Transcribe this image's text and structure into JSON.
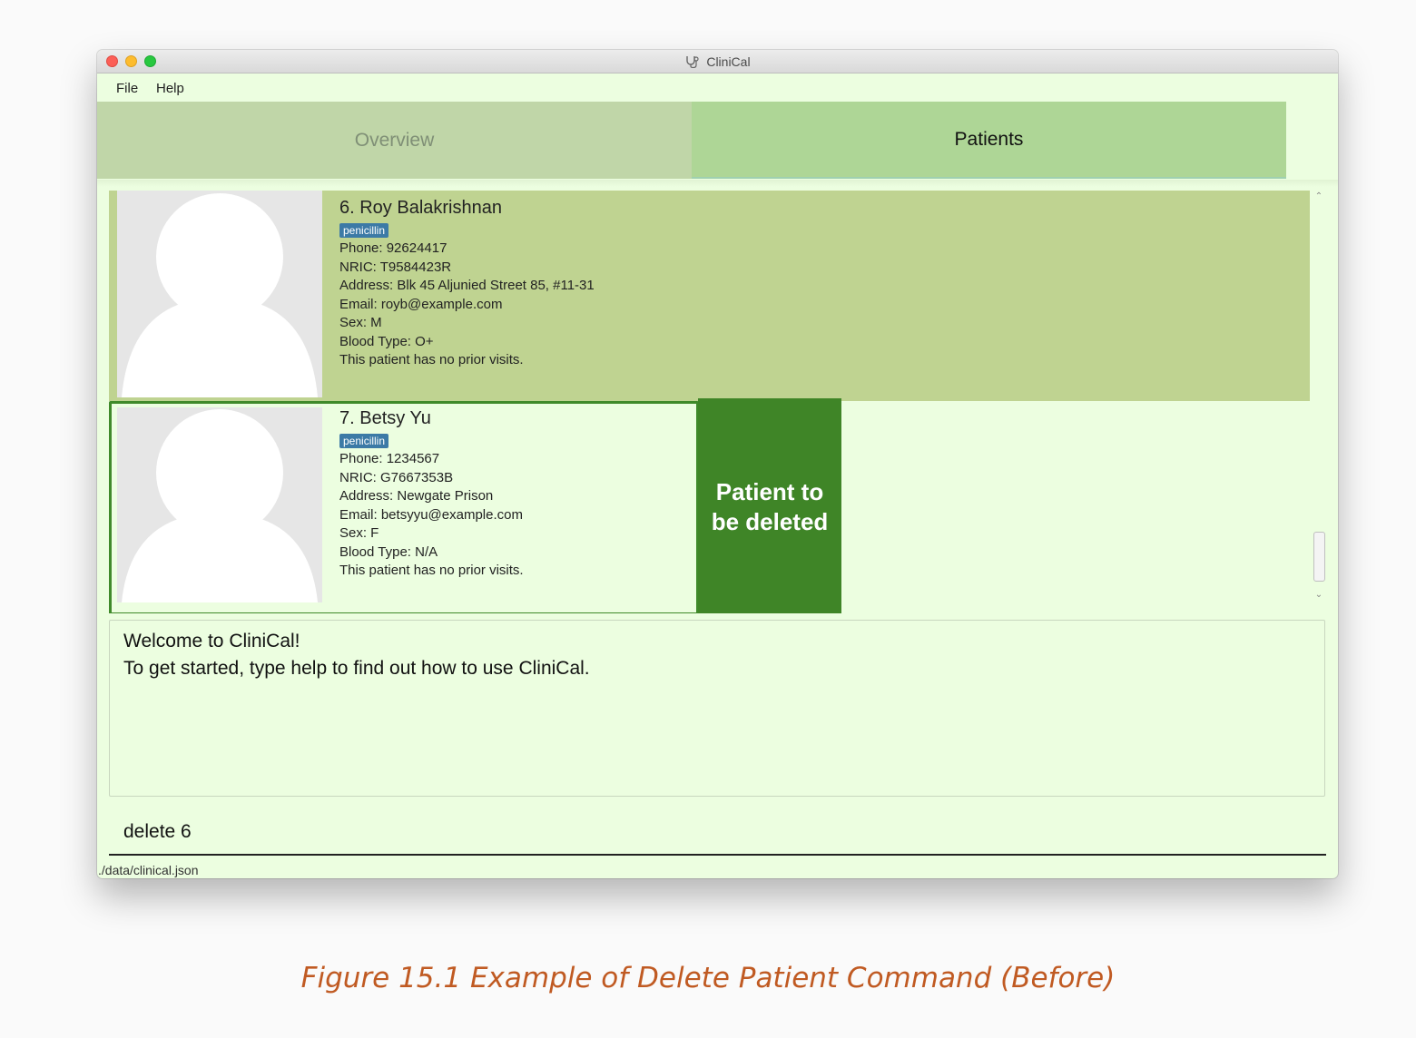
{
  "window": {
    "title": "CliniCal",
    "title_icon": "stethoscope-icon",
    "menu": [
      "File",
      "Help"
    ],
    "tabs": [
      {
        "label": "Overview",
        "selected": false
      },
      {
        "label": "Patients",
        "selected": true
      }
    ]
  },
  "patients": [
    {
      "name": "6.  Roy Balakrishnan",
      "tag": "penicillin",
      "lines": [
        "Phone: 92624417",
        "NRIC: T9584423R",
        "Address: Blk 45 Aljunied Street 85, #11-31",
        "Email: royb@example.com",
        "Sex: M",
        "Blood Type: O+",
        "This patient has no prior visits."
      ]
    },
    {
      "name": "7.  Betsy Yu",
      "tag": "penicillin",
      "lines": [
        "Phone: 1234567",
        "NRIC: G7667353B",
        "Address: Newgate Prison",
        "Email: betsyyu@example.com",
        "Sex: F",
        "Blood Type: N/A",
        "This patient has no prior visits."
      ]
    }
  ],
  "annotation": {
    "line1": "Patient to",
    "line2": "be deleted",
    "color": "#3f8527"
  },
  "result": {
    "line1": "Welcome to CliniCal!",
    "line2": "To get started, type help to find out how to use CliniCal."
  },
  "command": {
    "value": "delete 6"
  },
  "status": {
    "path": "./data/clinical.json"
  },
  "caption": "Figure 15.1 Example of Delete Patient Command (Before)",
  "colors": {
    "background": "#ecfee0",
    "selected_card": "#bfd391",
    "tag": "#3c7aa6",
    "caption": "#c05a22"
  }
}
